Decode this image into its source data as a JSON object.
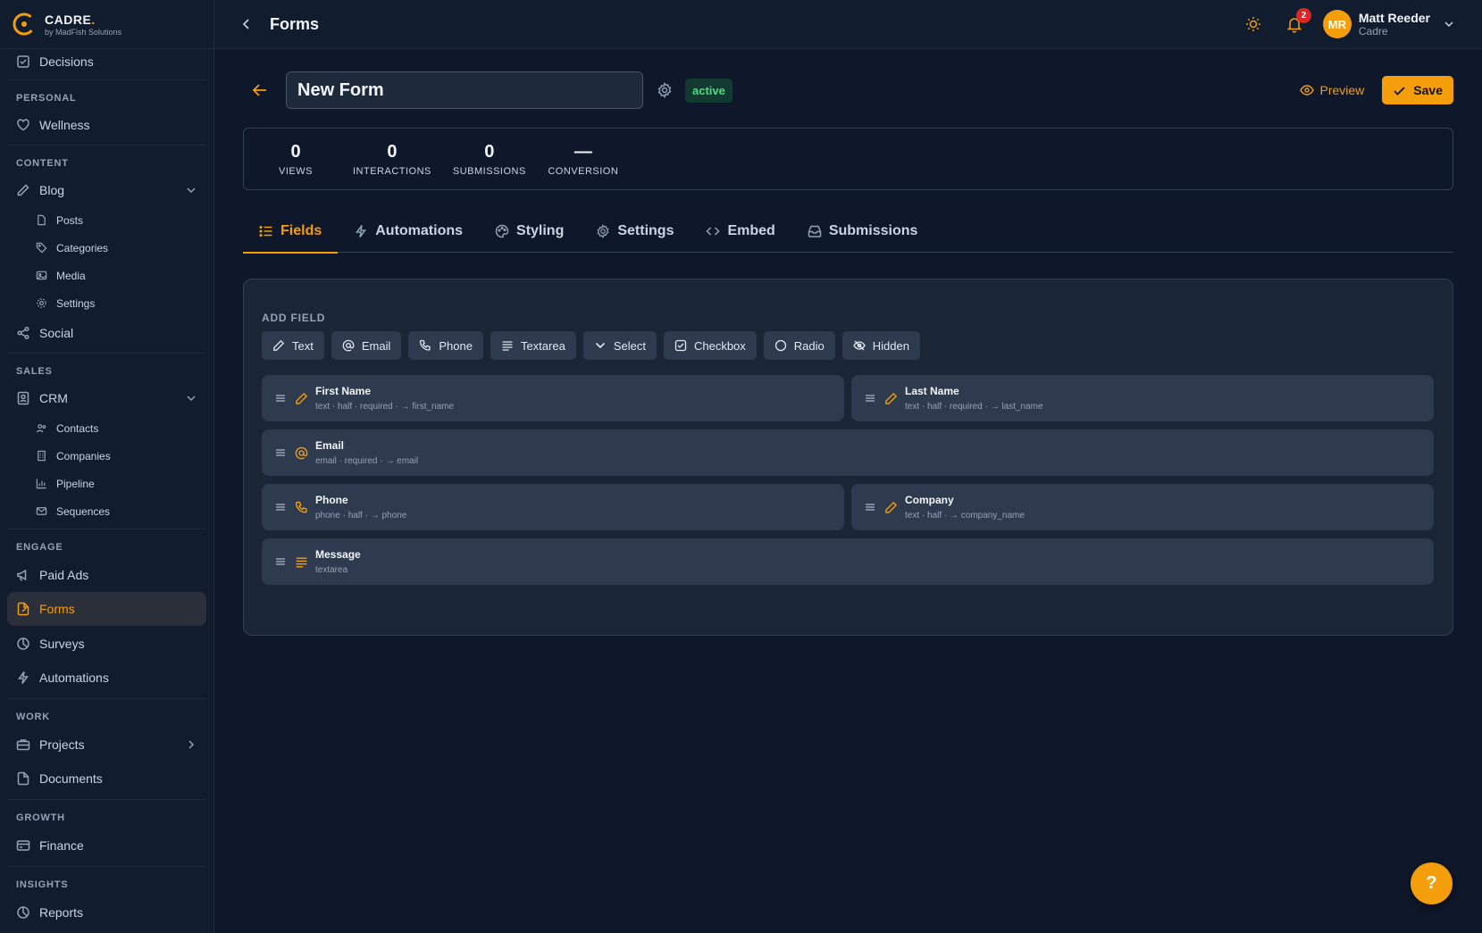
{
  "brand": {
    "name": "CADRE",
    "dot": ".",
    "subtitle": "by MadFish Solutions"
  },
  "sidebar": {
    "top_item": {
      "label": "Decisions",
      "icon": "checkbox-icon"
    },
    "sections": {
      "personal": {
        "label": "PERSONAL",
        "items": [
          {
            "label": "Wellness",
            "icon": "heart-icon"
          }
        ]
      },
      "content": {
        "label": "CONTENT",
        "blog": {
          "label": "Blog",
          "icon": "pencil-icon",
          "expanded": true
        },
        "blog_items": [
          {
            "label": "Posts",
            "icon": "document-icon"
          },
          {
            "label": "Categories",
            "icon": "tag-icon"
          },
          {
            "label": "Media",
            "icon": "image-icon"
          },
          {
            "label": "Settings",
            "icon": "gear-icon"
          }
        ],
        "social": {
          "label": "Social",
          "icon": "share-icon"
        }
      },
      "sales": {
        "label": "SALES",
        "crm": {
          "label": "CRM",
          "icon": "contact-book-icon",
          "expanded": true
        },
        "crm_items": [
          {
            "label": "Contacts",
            "icon": "users-icon"
          },
          {
            "label": "Companies",
            "icon": "building-icon"
          },
          {
            "label": "Pipeline",
            "icon": "bar-chart-icon"
          },
          {
            "label": "Sequences",
            "icon": "mail-icon"
          }
        ]
      },
      "engage": {
        "label": "ENGAGE",
        "items": [
          {
            "label": "Paid Ads",
            "icon": "megaphone-icon"
          },
          {
            "label": "Forms",
            "icon": "form-icon",
            "active": true
          },
          {
            "label": "Surveys",
            "icon": "pie-icon"
          },
          {
            "label": "Automations",
            "icon": "lightning-icon"
          }
        ]
      },
      "work": {
        "label": "WORK",
        "projects": {
          "label": "Projects",
          "icon": "briefcase-icon"
        },
        "documents": {
          "label": "Documents",
          "icon": "file-icon"
        }
      },
      "growth": {
        "label": "GROWTH",
        "finance": {
          "label": "Finance",
          "icon": "card-icon"
        }
      },
      "insights": {
        "label": "INSIGHTS",
        "reports": {
          "label": "Reports",
          "icon": "pie-icon"
        }
      }
    }
  },
  "topbar": {
    "title": "Forms",
    "notifications_count": "2",
    "user": {
      "initials": "MR",
      "name": "Matt Reeder",
      "org": "Cadre"
    }
  },
  "form": {
    "name": "New Form",
    "status": "active",
    "preview_label": "Preview",
    "save_label": "Save"
  },
  "stats": [
    {
      "value": "0",
      "label": "VIEWS"
    },
    {
      "value": "0",
      "label": "INTERACTIONS"
    },
    {
      "value": "0",
      "label": "SUBMISSIONS"
    },
    {
      "value": "—",
      "label": "CONVERSION"
    }
  ],
  "tabs": [
    {
      "label": "Fields",
      "icon": "list-icon",
      "active": true
    },
    {
      "label": "Automations",
      "icon": "lightning-icon"
    },
    {
      "label": "Styling",
      "icon": "palette-icon"
    },
    {
      "label": "Settings",
      "icon": "gear-icon"
    },
    {
      "label": "Embed",
      "icon": "code-icon"
    },
    {
      "label": "Submissions",
      "icon": "inbox-icon"
    }
  ],
  "add_field": {
    "label": "ADD FIELD",
    "types": [
      {
        "label": "Text",
        "icon": "pencil-icon"
      },
      {
        "label": "Email",
        "icon": "at-icon"
      },
      {
        "label": "Phone",
        "icon": "phone-icon"
      },
      {
        "label": "Textarea",
        "icon": "lines-icon"
      },
      {
        "label": "Select",
        "icon": "chevron-down-icon"
      },
      {
        "label": "Checkbox",
        "icon": "checkbox-icon"
      },
      {
        "label": "Radio",
        "icon": "circle-icon"
      },
      {
        "label": "Hidden",
        "icon": "eye-off-icon"
      }
    ]
  },
  "fields": [
    {
      "label": "First Name",
      "meta": "text · half · required · → first_name",
      "icon": "pencil-icon"
    },
    {
      "label": "Last Name",
      "meta": "text · half · required · → last_name",
      "icon": "pencil-icon"
    },
    {
      "label": "Email",
      "meta": "email · required · → email",
      "icon": "at-icon"
    },
    {
      "label": "Phone",
      "meta": "phone · half · → phone",
      "icon": "phone-icon"
    },
    {
      "label": "Company",
      "meta": "text · half · → company_name",
      "icon": "pencil-icon"
    },
    {
      "label": "Message",
      "meta": "textarea",
      "icon": "lines-icon"
    }
  ],
  "help": {
    "label": "?"
  },
  "colors": {
    "accent": "#f59e0b",
    "background": "#0f172a",
    "sidebar": "#111c2e",
    "status_green": "#4ade80",
    "badge_red": "#dc2626"
  }
}
